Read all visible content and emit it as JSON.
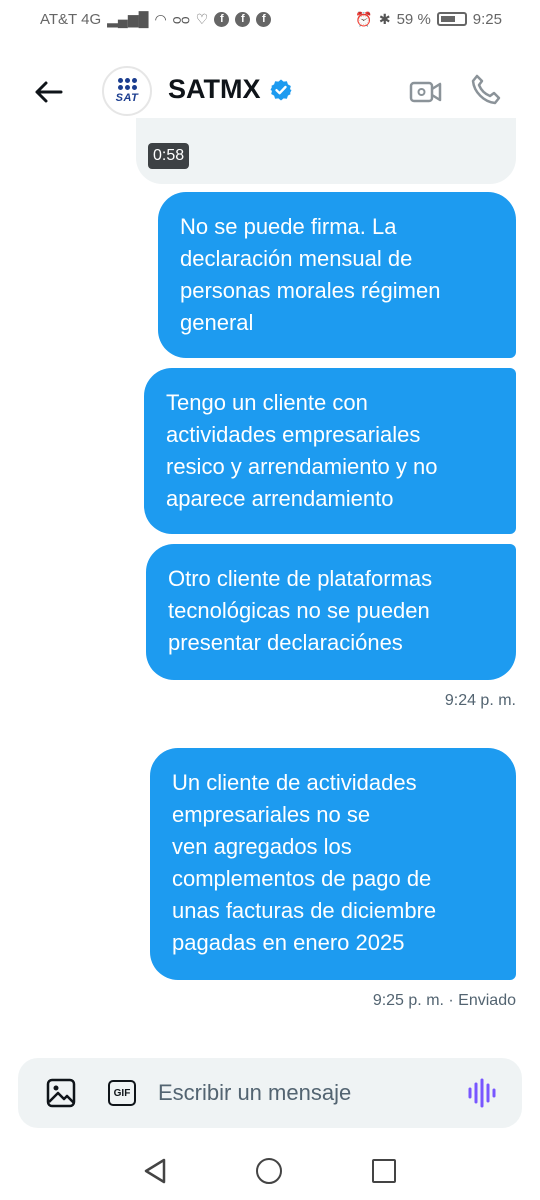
{
  "status_bar": {
    "carrier": "AT&T 4G",
    "network_sup": "4G",
    "battery_percent": "59 %",
    "time": "9:25"
  },
  "header": {
    "title": "SATMX",
    "avatar_text": "SAT"
  },
  "chat": {
    "audio_duration": "0:58",
    "messages": [
      {
        "text": "No se puede firma. La\ndeclaración mensual de\npersonas morales régimen\ngeneral"
      },
      {
        "text": "Tengo un cliente con\nactividades empresariales\nresico y arrendamiento y no\naparece arrendamiento"
      },
      {
        "text": "Otro cliente de plataformas\ntecnológicas no se pueden\npresentar declaraciónes"
      },
      {
        "text": "Un cliente de actividades\nempresariales no se\nven agregados los\ncomplementos de pago de\nunas facturas de diciembre\npagadas en enero 2025"
      }
    ],
    "timestamps": [
      "9:24 p. m.",
      "9:25 p. m. · Enviado"
    ]
  },
  "composer": {
    "placeholder": "Escribir un mensaje",
    "gif_label": "GIF"
  },
  "colors": {
    "bubble": "#1d9bf0",
    "verified": "#1d9bf0",
    "voice": "#7856ff"
  }
}
